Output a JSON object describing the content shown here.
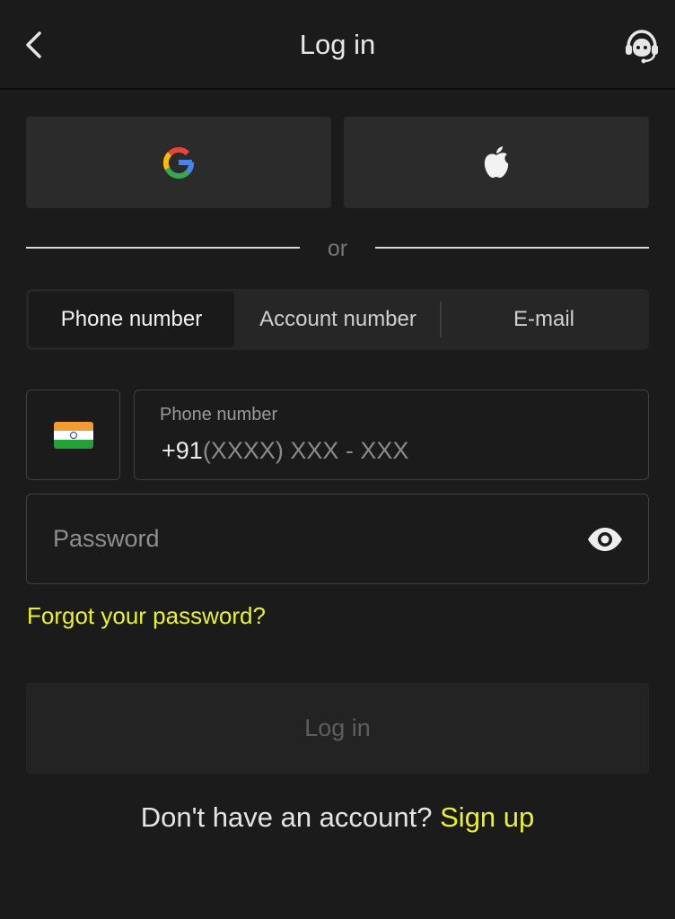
{
  "header": {
    "title": "Log in",
    "back_icon": "chevron-left-icon",
    "support_icon": "headset-support-icon"
  },
  "social": {
    "google_icon": "google-icon",
    "apple_icon": "apple-icon"
  },
  "divider": {
    "text": "or"
  },
  "tabs": [
    {
      "label": "Phone number",
      "active": true
    },
    {
      "label": "Account number",
      "active": false
    },
    {
      "label": "E-mail",
      "active": false
    }
  ],
  "phone": {
    "country_flag": "india-flag-icon",
    "label": "Phone number",
    "prefix": "+91",
    "mask": "(XXXX) XXX - XXX"
  },
  "password": {
    "placeholder": "Password",
    "toggle_icon": "eye-icon"
  },
  "forgot_label": "Forgot your password?",
  "login_label": "Log in",
  "signup": {
    "text": "Don't have an account?",
    "link": "Sign up"
  },
  "colors": {
    "background": "#1b1b1b",
    "accent": "#e9f22c",
    "surface": "#2b2b2b"
  }
}
